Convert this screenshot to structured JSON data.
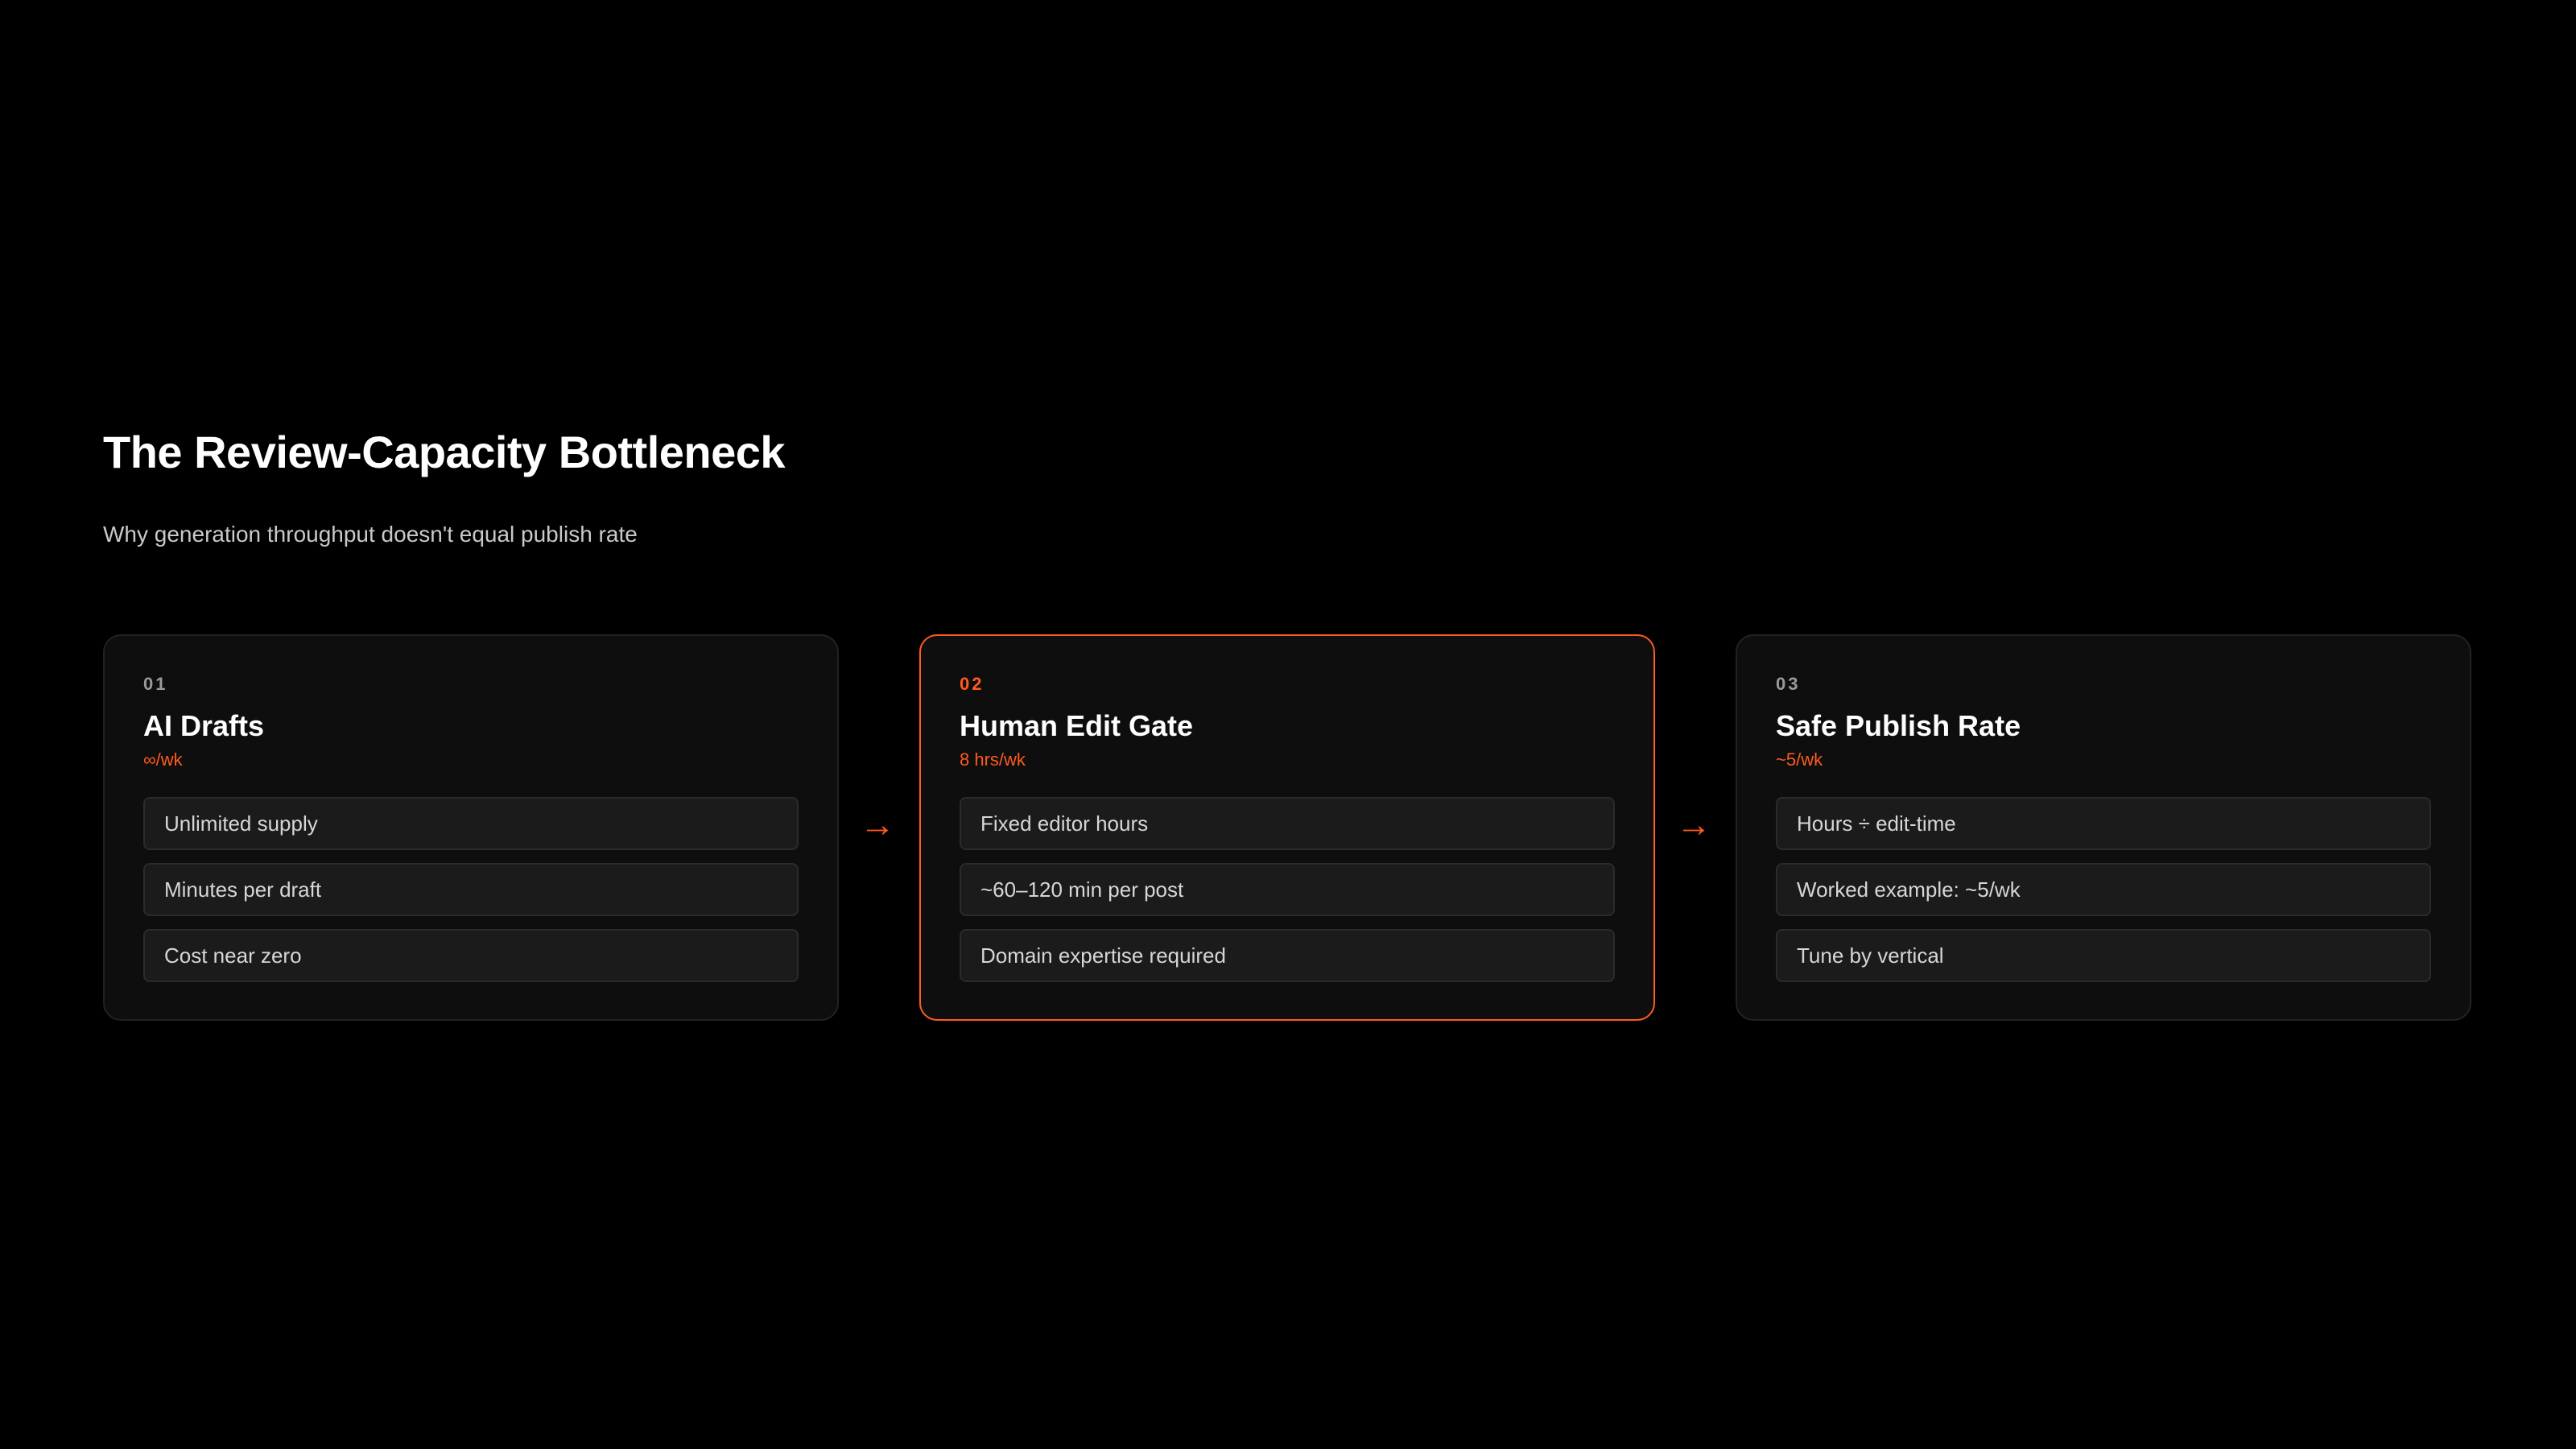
{
  "title": "The Review-Capacity Bottleneck",
  "subtitle": "Why generation throughput doesn't equal publish rate",
  "accent_color": "#ff5a1f",
  "arrow_glyph": "→",
  "stages": [
    {
      "number": "01",
      "title": "AI Drafts",
      "metric": "∞/wk",
      "highlighted": false,
      "items": [
        "Unlimited supply",
        "Minutes per draft",
        "Cost near zero"
      ]
    },
    {
      "number": "02",
      "title": "Human Edit Gate",
      "metric": "8 hrs/wk",
      "highlighted": true,
      "items": [
        "Fixed editor hours",
        "~60–120 min per post",
        "Domain expertise required"
      ]
    },
    {
      "number": "03",
      "title": "Safe Publish Rate",
      "metric": "~5/wk",
      "highlighted": false,
      "items": [
        "Hours ÷ edit-time",
        "Worked example: ~5/wk",
        "Tune by vertical"
      ]
    }
  ]
}
